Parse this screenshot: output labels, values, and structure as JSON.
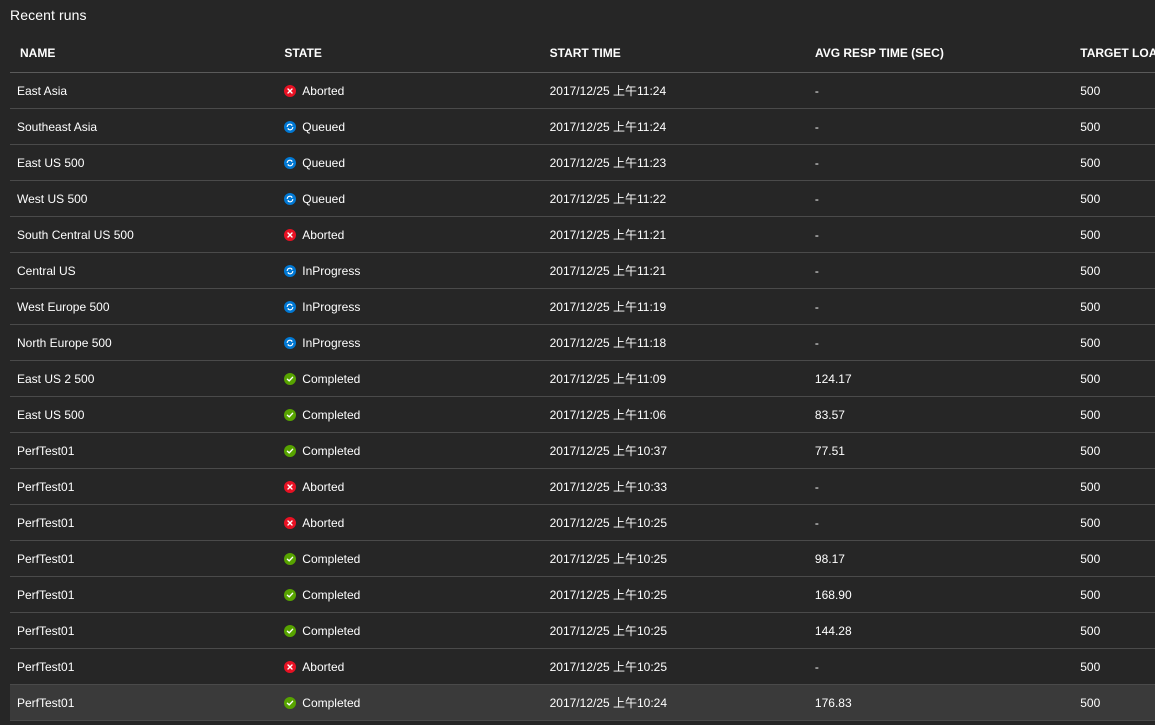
{
  "panel": {
    "title": "Recent runs"
  },
  "columns": {
    "name": "NAME",
    "state": "STATE",
    "start_time": "START TIME",
    "avg_resp": "AVG RESP TIME (SEC)",
    "target_load": "TARGET LOA"
  },
  "state_colors": {
    "Aborted": "#e81123",
    "Queued": "#0078d4",
    "InProgress": "#0078d4",
    "Completed": "#57a300"
  },
  "rows": [
    {
      "name": "East Asia",
      "state": "Aborted",
      "icon": "error-icon",
      "start": "2017/12/25 上午11:24",
      "avg": "-",
      "target": "500"
    },
    {
      "name": "Southeast Asia",
      "state": "Queued",
      "icon": "sync-icon",
      "start": "2017/12/25 上午11:24",
      "avg": "-",
      "target": "500"
    },
    {
      "name": "East US 500",
      "state": "Queued",
      "icon": "sync-icon",
      "start": "2017/12/25 上午11:23",
      "avg": "-",
      "target": "500"
    },
    {
      "name": "West US 500",
      "state": "Queued",
      "icon": "sync-icon",
      "start": "2017/12/25 上午11:22",
      "avg": "-",
      "target": "500"
    },
    {
      "name": "South Central US 500",
      "state": "Aborted",
      "icon": "error-icon",
      "start": "2017/12/25 上午11:21",
      "avg": "-",
      "target": "500"
    },
    {
      "name": "Central US",
      "state": "InProgress",
      "icon": "sync-icon",
      "start": "2017/12/25 上午11:21",
      "avg": "-",
      "target": "500"
    },
    {
      "name": "West Europe 500",
      "state": "InProgress",
      "icon": "sync-icon",
      "start": "2017/12/25 上午11:19",
      "avg": "-",
      "target": "500"
    },
    {
      "name": "North Europe 500",
      "state": "InProgress",
      "icon": "sync-icon",
      "start": "2017/12/25 上午11:18",
      "avg": "-",
      "target": "500"
    },
    {
      "name": "East US 2 500",
      "state": "Completed",
      "icon": "check-icon",
      "start": "2017/12/25 上午11:09",
      "avg": "124.17",
      "target": "500"
    },
    {
      "name": "East US 500",
      "state": "Completed",
      "icon": "check-icon",
      "start": "2017/12/25 上午11:06",
      "avg": "83.57",
      "target": "500"
    },
    {
      "name": "PerfTest01",
      "state": "Completed",
      "icon": "check-icon",
      "start": "2017/12/25 上午10:37",
      "avg": "77.51",
      "target": "500"
    },
    {
      "name": "PerfTest01",
      "state": "Aborted",
      "icon": "error-icon",
      "start": "2017/12/25 上午10:33",
      "avg": "-",
      "target": "500"
    },
    {
      "name": "PerfTest01",
      "state": "Aborted",
      "icon": "error-icon",
      "start": "2017/12/25 上午10:25",
      "avg": "-",
      "target": "500"
    },
    {
      "name": "PerfTest01",
      "state": "Completed",
      "icon": "check-icon",
      "start": "2017/12/25 上午10:25",
      "avg": "98.17",
      "target": "500"
    },
    {
      "name": "PerfTest01",
      "state": "Completed",
      "icon": "check-icon",
      "start": "2017/12/25 上午10:25",
      "avg": "168.90",
      "target": "500"
    },
    {
      "name": "PerfTest01",
      "state": "Completed",
      "icon": "check-icon",
      "start": "2017/12/25 上午10:25",
      "avg": "144.28",
      "target": "500"
    },
    {
      "name": "PerfTest01",
      "state": "Aborted",
      "icon": "error-icon",
      "start": "2017/12/25 上午10:25",
      "avg": "-",
      "target": "500"
    },
    {
      "name": "PerfTest01",
      "state": "Completed",
      "icon": "check-icon",
      "start": "2017/12/25 上午10:24",
      "avg": "176.83",
      "target": "500",
      "selected": true
    }
  ]
}
